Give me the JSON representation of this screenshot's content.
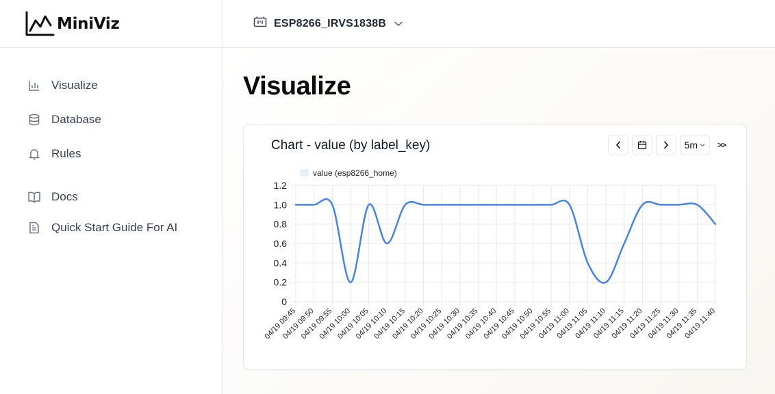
{
  "app": {
    "brand": "MiniViz"
  },
  "sidebar": {
    "items": [
      {
        "label": "Visualize",
        "icon": "bar-chart-icon"
      },
      {
        "label": "Database",
        "icon": "database-icon"
      },
      {
        "label": "Rules",
        "icon": "bell-icon"
      },
      {
        "label": "Docs",
        "icon": "book-icon"
      },
      {
        "label": "Quick Start Guide For AI",
        "icon": "document-icon"
      }
    ]
  },
  "topbar": {
    "device": "ESP8266_IRVS1838B",
    "icon": "device-icon"
  },
  "page": {
    "title": "Visualize"
  },
  "card": {
    "title": "Chart - value (by label_key)",
    "controls": {
      "range": "5m",
      "more": ">>"
    }
  },
  "colors": {
    "line": "#4384ea",
    "legend_swatch": "#e8f0fc",
    "grid": "#e5e7eb"
  },
  "chart_data": {
    "type": "line",
    "series": [
      {
        "name": "value (esp8266_home)",
        "x": [
          "04/19 09:45",
          "04/19 09:50",
          "04/19 09:55",
          "04/19 10:00",
          "04/19 10:05",
          "04/19 10:10",
          "04/19 10:15",
          "04/19 10:20",
          "04/19 10:25",
          "04/19 10:30",
          "04/19 10:35",
          "04/19 10:40",
          "04/19 10:45",
          "04/19 10:50",
          "04/19 10:55",
          "04/19 11:00",
          "04/19 11:05",
          "04/19 11:10",
          "04/19 11:15",
          "04/19 11:20",
          "04/19 11:25",
          "04/19 11:30",
          "04/19 11:35",
          "04/19 11:40"
        ],
        "values": [
          1.0,
          1.0,
          1.0,
          0.2,
          1.0,
          0.6,
          1.0,
          1.0,
          1.0,
          1.0,
          1.0,
          1.0,
          1.0,
          1.0,
          1.0,
          1.0,
          0.4,
          0.2,
          0.6,
          1.0,
          1.0,
          1.0,
          1.0,
          0.8
        ]
      }
    ],
    "yticks": [
      "1.2",
      "1.0",
      "0.8",
      "0.6",
      "0.4",
      "0.2",
      "0"
    ],
    "ylim": [
      0,
      1.2
    ],
    "grid": true,
    "legend": "top-left"
  }
}
